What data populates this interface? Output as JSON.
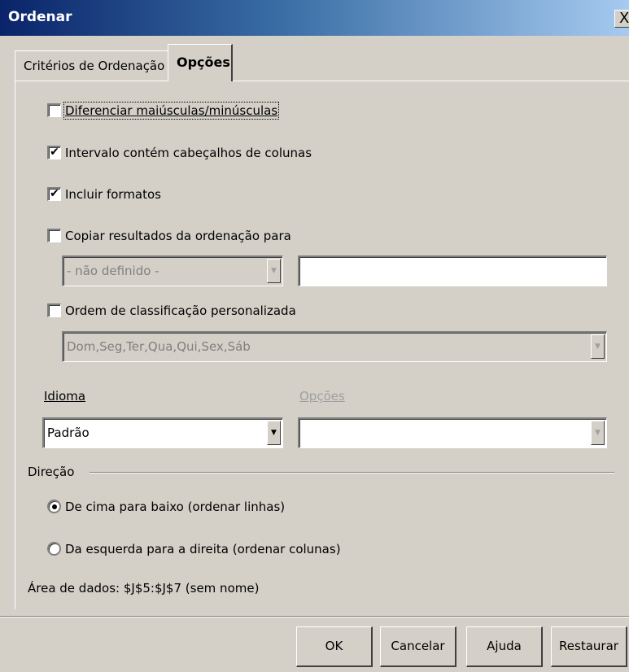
{
  "window": {
    "title": "Ordenar",
    "close_glyph": "X"
  },
  "tabs": [
    {
      "label": "Critérios de Ordenação",
      "active": false
    },
    {
      "label": "Opções",
      "active": true
    }
  ],
  "options": {
    "case_sensitive": {
      "label": "Diferenciar maiúsculas/minúsculas",
      "checked": false
    },
    "has_headers": {
      "label": "Intervalo contém cabeçalhos de colunas",
      "checked": true
    },
    "include_formats": {
      "label": "Incluir formatos",
      "checked": true
    },
    "copy_results": {
      "label": "Copiar resultados da ordenação para",
      "checked": false
    },
    "copy_target_select": {
      "value": "- não definido -"
    },
    "copy_target_input": {
      "value": ""
    },
    "custom_order": {
      "label": "Ordem de classificação personalizada",
      "checked": false
    },
    "custom_order_select": {
      "value": "Dom,Seg,Ter,Qua,Qui,Sex,Sáb"
    },
    "language_label": "Idioma",
    "language_select": {
      "value": "Padrão"
    },
    "lang_options_label": "Opções",
    "lang_options_select": {
      "value": ""
    }
  },
  "direction": {
    "label": "Direção",
    "top_to_bottom": {
      "label": "De cima para baixo (ordenar linhas)",
      "selected": true
    },
    "left_to_right": {
      "label": "Da esquerda para a direita (ordenar colunas)",
      "selected": false
    }
  },
  "data_area": "Área de dados: $J$5:$J$7 (sem nome)",
  "buttons": {
    "ok": "OK",
    "cancel": "Cancelar",
    "help": "Ajuda",
    "reset": "Restaurar"
  },
  "check_glyph": "✔",
  "dropdown_glyph": "▼",
  "colors": {
    "title_start": "#0a246a",
    "title_end": "#a6caf0",
    "face": "#d4d0c8"
  }
}
